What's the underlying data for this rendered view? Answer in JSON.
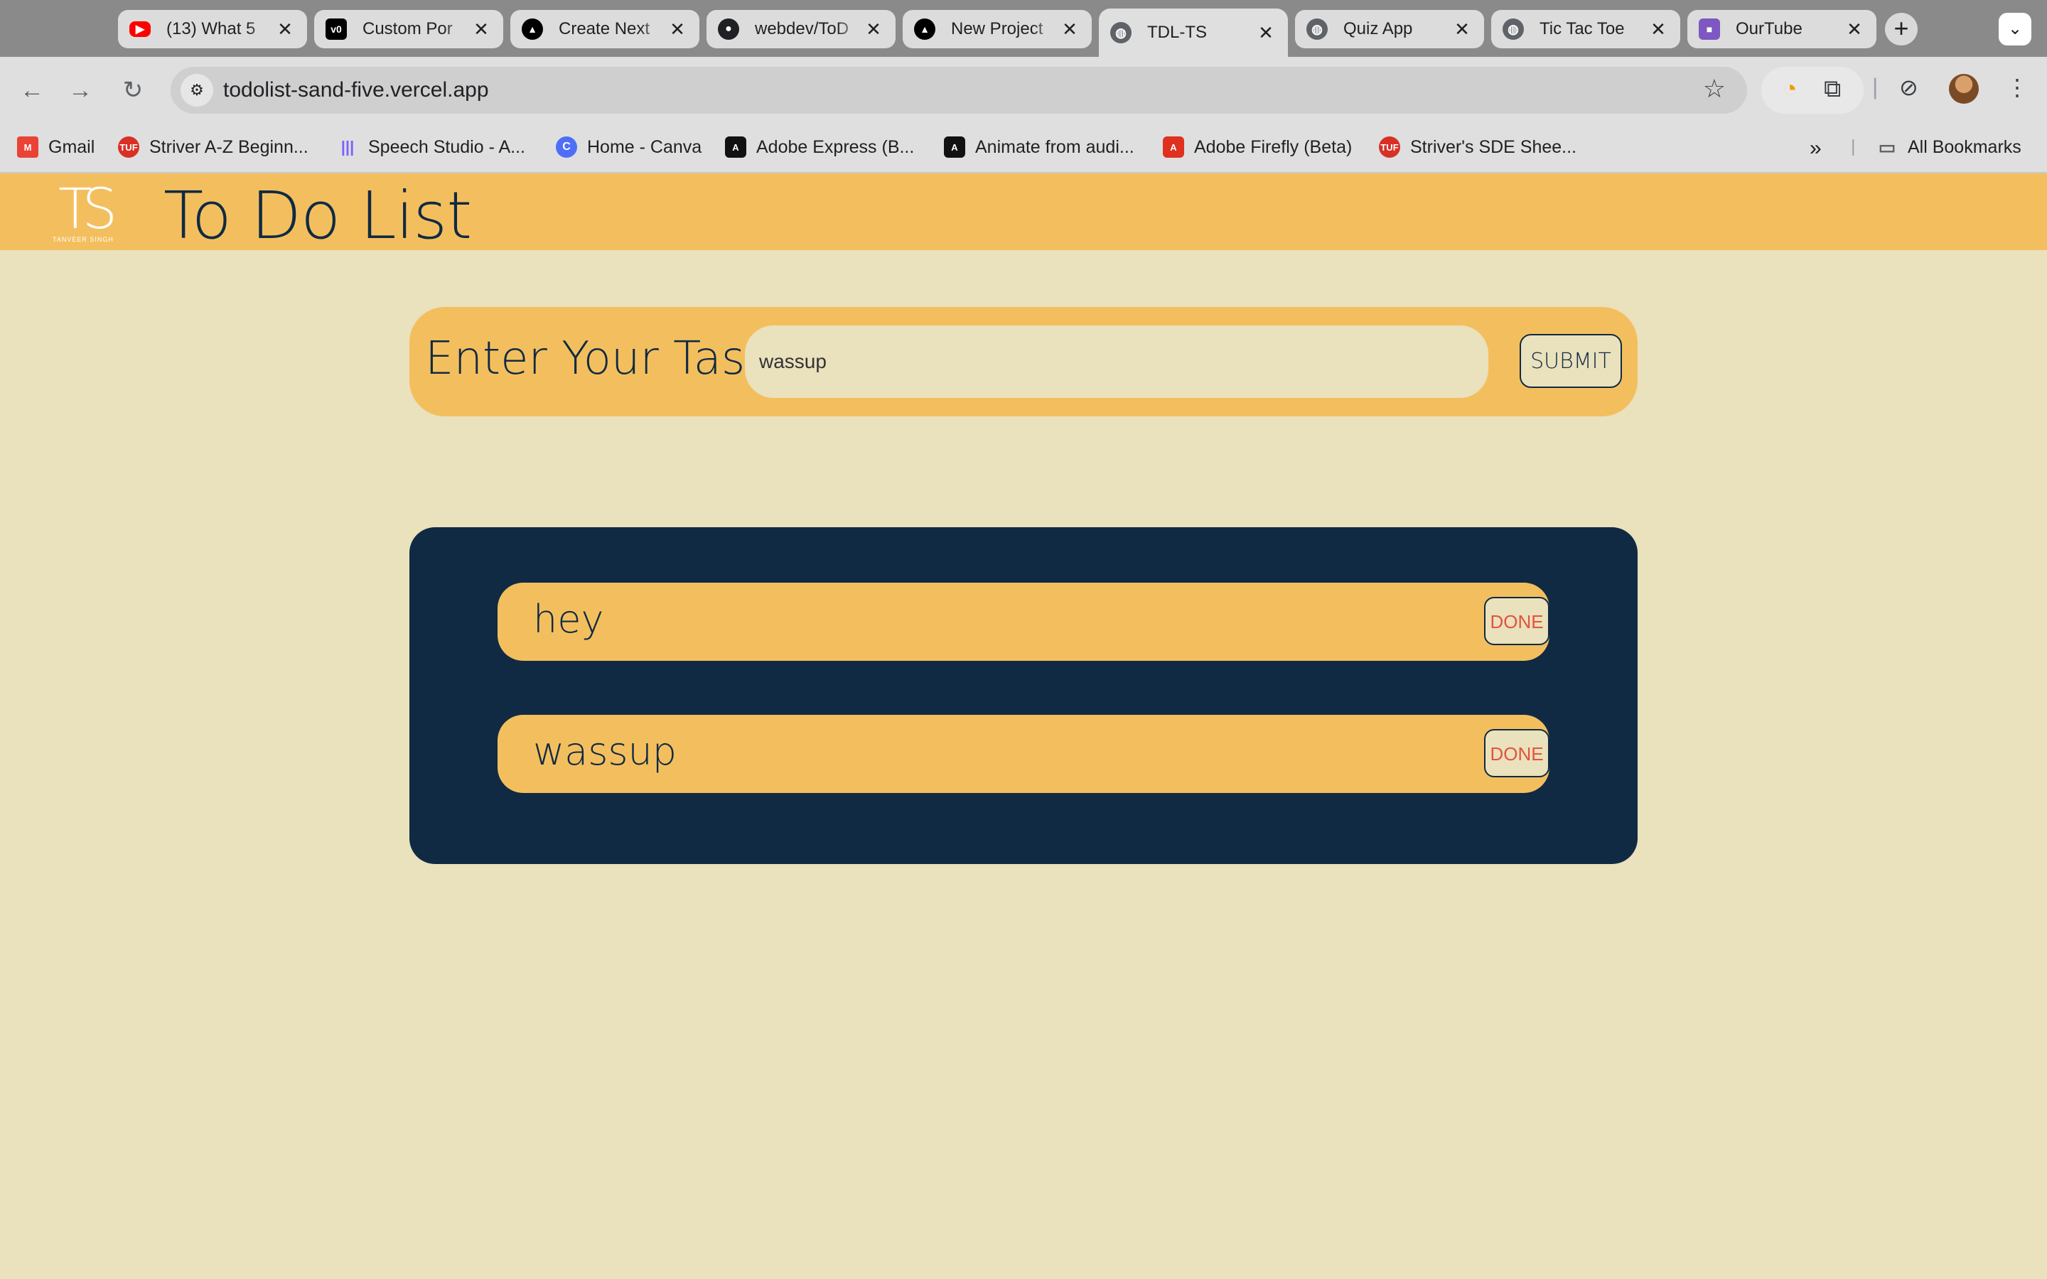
{
  "browser": {
    "tabs": [
      {
        "title": "(13) What 5",
        "icon": "youtube-icon",
        "color": "#ff0000",
        "active": false
      },
      {
        "title": "Custom Por",
        "icon": "vercel-v0-icon",
        "color": "#000000",
        "active": false
      },
      {
        "title": "Create Next",
        "icon": "vercel-triangle-icon",
        "color": "#000000",
        "active": false
      },
      {
        "title": "webdev/ToD",
        "icon": "github-icon",
        "color": "#202124",
        "active": false
      },
      {
        "title": "New Project",
        "icon": "vercel-triangle-icon",
        "color": "#000000",
        "active": false
      },
      {
        "title": "TDL-TS",
        "icon": "globe-icon",
        "color": "#5f6368",
        "active": true
      },
      {
        "title": "Quiz App",
        "icon": "globe-icon",
        "color": "#5f6368",
        "active": false
      },
      {
        "title": "Tic Tac Toe",
        "icon": "globe-icon",
        "color": "#5f6368",
        "active": false
      },
      {
        "title": "OurTube",
        "icon": "video-camera-icon",
        "color": "#7e57c2",
        "active": false
      }
    ],
    "url": "todolist-sand-five.vercel.app",
    "bookmarks": [
      {
        "label": "Gmail",
        "icon": "gmail-icon",
        "color": "#ea4335"
      },
      {
        "label": "Striver A-Z Beginn...",
        "icon": "tuf-icon",
        "color": "#d93025"
      },
      {
        "label": "Speech Studio - A...",
        "icon": "audio-wave-icon",
        "color": "#7b61ff"
      },
      {
        "label": "Home - Canva",
        "icon": "canva-icon",
        "color": "#4f6ef7"
      },
      {
        "label": "Adobe Express (B...",
        "icon": "adobe-express-icon",
        "color": "#111111"
      },
      {
        "label": "Animate from audi...",
        "icon": "adobe-express-icon",
        "color": "#111111"
      },
      {
        "label": "Adobe Firefly (Beta)",
        "icon": "adobe-firefly-icon",
        "color": "#e0301e"
      },
      {
        "label": "Striver's SDE Shee...",
        "icon": "tuf-icon",
        "color": "#d93025"
      }
    ],
    "all_bookmarks_label": "All Bookmarks"
  },
  "app": {
    "logo_mark": "TS",
    "logo_tagline": "TANVEER SINGH",
    "title": "To Do List",
    "form": {
      "label": "Enter Your Task",
      "input_value": "wassup",
      "submit_label": "SUBMIT"
    },
    "tasks": [
      {
        "text": "hey",
        "action_label": "DONE"
      },
      {
        "text": "wassup",
        "action_label": "DONE"
      }
    ]
  },
  "colors": {
    "header_bg": "#f3bf5e",
    "page_bg": "#eae1bd",
    "list_bg": "#102a43",
    "done_text": "#e2533d"
  }
}
